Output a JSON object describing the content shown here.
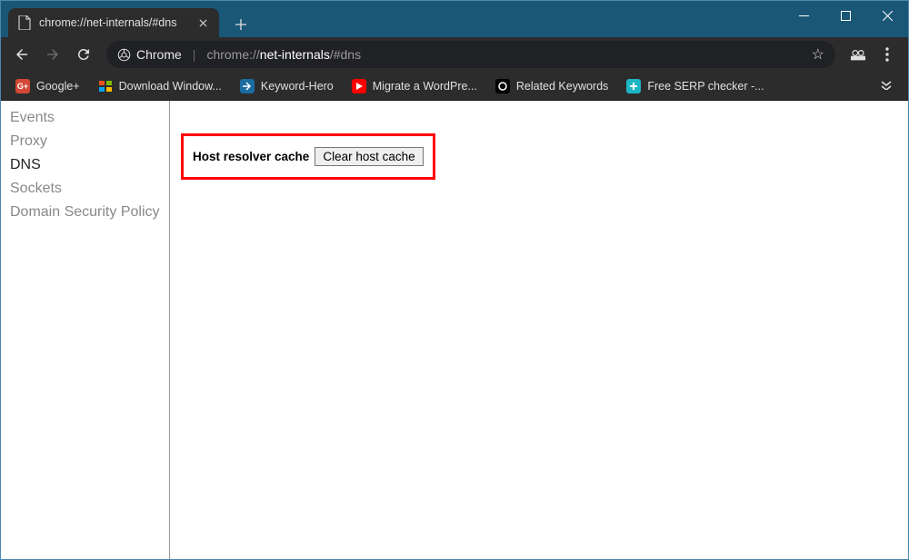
{
  "window": {
    "tab_title": "chrome://net-internals/#dns"
  },
  "toolbar": {
    "origin_label": "Chrome",
    "url_host": "chrome://",
    "url_path_bold": "net-internals",
    "url_path_rest": "/#dns"
  },
  "bookmarks": {
    "items": [
      {
        "label": "Google+",
        "bg": "#d34836",
        "glyph": "G+"
      },
      {
        "label": "Download Window...",
        "bg": "",
        "glyph": "⊞"
      },
      {
        "label": "Keyword-Hero",
        "bg": "#1a6b9f",
        "glyph": "⟶"
      },
      {
        "label": "Migrate a WordPre...",
        "bg": "#ff0000",
        "glyph": "▶"
      },
      {
        "label": "Related Keywords",
        "bg": "#000000",
        "glyph": "◯"
      },
      {
        "label": "Free SERP checker -...",
        "bg": "#1db4c4",
        "glyph": "✚"
      }
    ]
  },
  "sidebar": {
    "items": [
      {
        "label": "Events",
        "active": false
      },
      {
        "label": "Proxy",
        "active": false
      },
      {
        "label": "DNS",
        "active": true
      },
      {
        "label": "Sockets",
        "active": false
      },
      {
        "label": "Domain Security Policy",
        "active": false
      }
    ]
  },
  "main": {
    "cache_label": "Host resolver cache",
    "clear_button": "Clear host cache"
  }
}
